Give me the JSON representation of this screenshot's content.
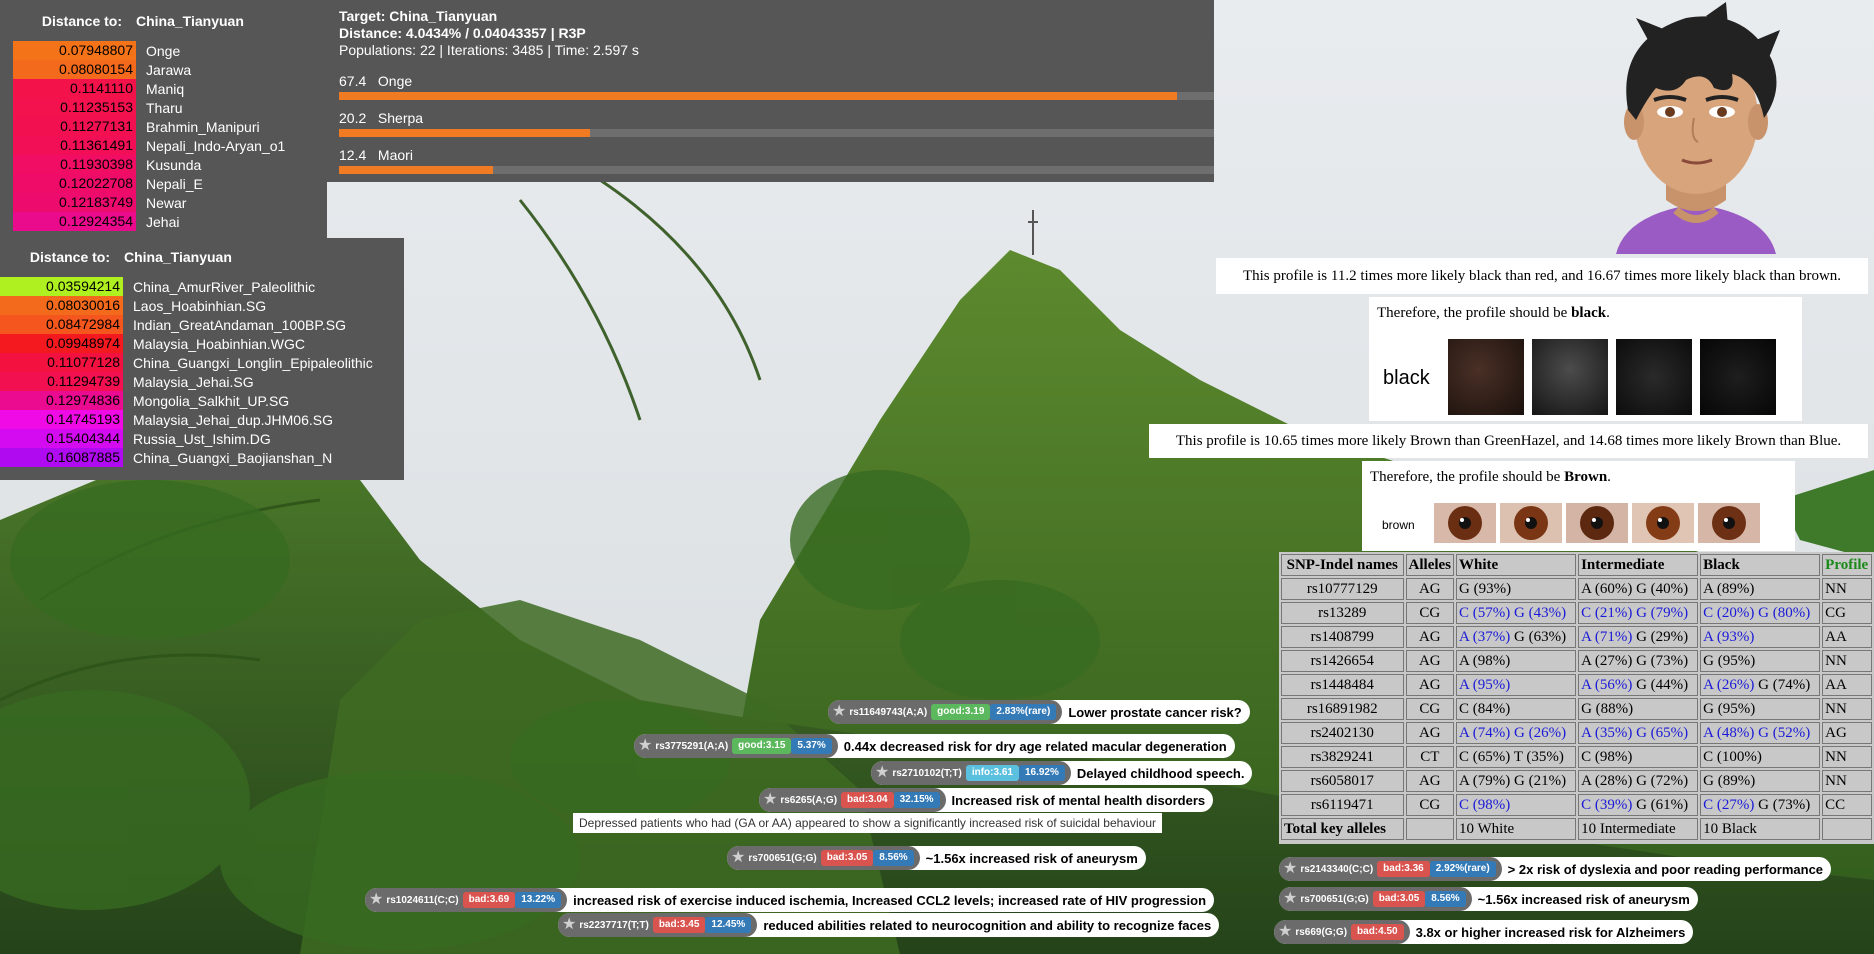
{
  "distance_panel_1": {
    "header_label": "Distance to:",
    "header_target": "China_Tianyuan",
    "rows": [
      {
        "value": "0.07948807",
        "name": "Onge",
        "color": "#f47318"
      },
      {
        "value": "0.08080154",
        "name": "Jarawa",
        "color": "#f46a1c"
      },
      {
        "value": "0.1141110",
        "name": "Maniq",
        "color": "#f3124a"
      },
      {
        "value": "0.11235153",
        "name": "Tharu",
        "color": "#f3114e"
      },
      {
        "value": "0.11277131",
        "name": "Brahmin_Manipuri",
        "color": "#f31051"
      },
      {
        "value": "0.11361491",
        "name": "Nepali_Indo-Aryan_o1",
        "color": "#f30f55"
      },
      {
        "value": "0.11930398",
        "name": "Kusunda",
        "color": "#f00d63"
      },
      {
        "value": "0.12022708",
        "name": "Nepali_E",
        "color": "#ef0c68"
      },
      {
        "value": "0.12183749",
        "name": "Newar",
        "color": "#ee0b6e"
      },
      {
        "value": "0.12924354",
        "name": "Jehai",
        "color": "#ea0b8c"
      }
    ]
  },
  "distance_panel_2": {
    "header_label": "Distance to:",
    "header_target": "China_Tianyuan",
    "rows": [
      {
        "value": "0.03594214",
        "name": "China_AmurRiver_Paleolithic",
        "color": "#aef020"
      },
      {
        "value": "0.08030016",
        "name": "Laos_Hoabinhian.SG",
        "color": "#f46a1c"
      },
      {
        "value": "0.08472984",
        "name": "Indian_GreatAndaman_100BP.SG",
        "color": "#f4561e"
      },
      {
        "value": "0.09948974",
        "name": "Malaysia_Hoabinhian.WGC",
        "color": "#f4191e"
      },
      {
        "value": "0.11077128",
        "name": "China_Guangxi_Longlin_Epipaleolithic",
        "color": "#f3123f"
      },
      {
        "value": "0.11294739",
        "name": "Malaysia_Jehai.SG",
        "color": "#f31050"
      },
      {
        "value": "0.12974836",
        "name": "Mongolia_Salkhit_UP.SG",
        "color": "#ea0b90"
      },
      {
        "value": "0.14745193",
        "name": "Malaysia_Jehai_dup.JHM06.SG",
        "color": "#f00ae6"
      },
      {
        "value": "0.15404344",
        "name": "Russia_Ust_Ishim.DG",
        "color": "#d40af0"
      },
      {
        "value": "0.16087885",
        "name": "China_Guangxi_Baojianshan_N",
        "color": "#b00af0"
      }
    ]
  },
  "target_panel": {
    "target_line": "Target: China_Tianyuan",
    "distance_line": "Distance: 4.0434% / 0.04043357 | R3P",
    "stats_line": "Populations: 22 | Iterations: 3485 | Time: 2.597 s",
    "entries": [
      {
        "label": "67.4   Onge",
        "percent": 67.4
      },
      {
        "label": "20.2   Sherpa",
        "percent": 20.2
      },
      {
        "label": "12.4   Maori",
        "percent": 12.4
      }
    ]
  },
  "hair": {
    "ratio_text": "This profile is 11.2 times more likely black than red, and 16.67 times more likely black than brown.",
    "conclusion_prefix": "Therefore, the profile should be ",
    "conclusion_value": "black",
    "conclusion_suffix": ".",
    "swatch_label": "black"
  },
  "eyes": {
    "ratio_text": "This profile is 10.65 times more likely Brown than GreenHazel, and 14.68 times more likely Brown than Blue.",
    "conclusion_prefix": "Therefore, the profile should be ",
    "conclusion_value": "Brown",
    "conclusion_suffix": ".",
    "swatch_label": "brown"
  },
  "snp_table": {
    "headers": [
      "SNP-Indel names",
      "Alleles",
      "White",
      "Intermediate",
      "Black",
      "Profile"
    ],
    "rows": [
      {
        "name": "rs10777129",
        "alleles": "AG",
        "white": "G (93%)",
        "white_blue": false,
        "inter": "A (60%) G (40%)",
        "inter_blue": false,
        "black": "A (89%)",
        "black_blue": false,
        "profile": "NN"
      },
      {
        "name": "rs13289",
        "alleles": "CG",
        "white": "C (57%) G (43%)",
        "white_blue": true,
        "inter": "C (21%) G (79%)",
        "inter_blue": true,
        "black": "C (20%) G (80%)",
        "black_blue": true,
        "profile": "CG"
      },
      {
        "name": "rs1408799",
        "alleles": "AG",
        "white": "A (37%) G (63%)",
        "white_blue": "partial",
        "inter": "A (71%) G (29%)",
        "inter_blue": "partial",
        "black": "A (93%)",
        "black_blue": true,
        "profile": "AA"
      },
      {
        "name": "rs1426654",
        "alleles": "AG",
        "white": "A (98%)",
        "white_blue": false,
        "inter": "A (27%) G (73%)",
        "inter_blue": false,
        "black": "G (95%)",
        "black_blue": false,
        "profile": "NN"
      },
      {
        "name": "rs1448484",
        "alleles": "AG",
        "white": "A (95%)",
        "white_blue": true,
        "inter": "A (56%) G (44%)",
        "inter_blue": "partial",
        "black": "A (26%) G (74%)",
        "black_blue": "partial",
        "profile": "AA"
      },
      {
        "name": "rs16891982",
        "alleles": "CG",
        "white": "C (84%)",
        "white_blue": false,
        "inter": "G (88%)",
        "inter_blue": false,
        "black": "G (95%)",
        "black_blue": false,
        "profile": "NN"
      },
      {
        "name": "rs2402130",
        "alleles": "AG",
        "white": "A (74%) G (26%)",
        "white_blue": true,
        "inter": "A (35%) G (65%)",
        "inter_blue": true,
        "black": "A (48%) G (52%)",
        "black_blue": true,
        "profile": "AG"
      },
      {
        "name": "rs3829241",
        "alleles": "CT",
        "white": "C (65%) T (35%)",
        "white_blue": false,
        "inter": "C (98%)",
        "inter_blue": false,
        "black": "C (100%)",
        "black_blue": false,
        "profile": "NN"
      },
      {
        "name": "rs6058017",
        "alleles": "AG",
        "white": "A (79%) G (21%)",
        "white_blue": false,
        "inter": "A (28%) G (72%)",
        "inter_blue": false,
        "black": "G (89%)",
        "black_blue": false,
        "profile": "NN"
      },
      {
        "name": "rs6119471",
        "alleles": "CG",
        "white": "C (98%)",
        "white_blue": true,
        "inter": "C (39%) G (61%)",
        "inter_blue": "partial",
        "black": "C (27%) G (73%)",
        "black_blue": "partial",
        "profile": "CC"
      }
    ],
    "total_label": "Total key alleles",
    "total_white": "10 White",
    "total_inter": "10 Intermediate",
    "total_black": "10 Black"
  },
  "pills": [
    {
      "rsid": "rs11649743(A;A)",
      "badge": "good:3.19",
      "kind": "good",
      "pct": "2.83%(rare)",
      "text": "Lower prostate cancer risk?"
    },
    {
      "rsid": "rs3775291(A;A)",
      "badge": "good:3.15",
      "kind": "good",
      "pct": "5.37%",
      "text": "0.44x decreased risk for dry age related macular degeneration"
    },
    {
      "rsid": "rs2710102(T;T)",
      "badge": "info:3.61",
      "kind": "info",
      "pct": "16.92%",
      "text": "Delayed childhood speech."
    },
    {
      "rsid": "rs6265(A;G)",
      "badge": "bad:3.04",
      "kind": "bad",
      "pct": "32.15%",
      "text": "Increased risk of mental health disorders"
    },
    {
      "rsid": "rs700651(G;G)",
      "badge": "bad:3.05",
      "kind": "bad",
      "pct": "8.56%",
      "text": "~1.56x increased risk of aneurysm"
    },
    {
      "rsid": "rs1024611(C;C)",
      "badge": "bad:3.69",
      "kind": "bad",
      "pct": "13.22%",
      "text": "increased risk of exercise induced ischemia, Increased CCL2 levels; increased rate of HIV progression"
    },
    {
      "rsid": "rs2237717(T;T)",
      "badge": "bad:3.45",
      "kind": "bad",
      "pct": "12.45%",
      "text": "reduced abilities related to neurocognition and ability to recognize faces"
    },
    {
      "rsid": "rs2143340(C;C)",
      "badge": "bad:3.36",
      "kind": "bad",
      "pct": "2.92%(rare)",
      "text": "> 2x risk of dyslexia and poor reading performance"
    },
    {
      "rsid": "rs700651(G;G)",
      "badge": "bad:3.05",
      "kind": "bad",
      "pct": "8.56%",
      "text": "~1.56x increased risk of aneurysm"
    },
    {
      "rsid": "rs669(G;G)",
      "badge": "bad:4.50",
      "kind": "bad",
      "pct": "",
      "text": "3.8x or higher increased risk for Alzheimers"
    }
  ],
  "note_suicide": "Depressed patients who had (GA or AA) appeared to show a significantly increased risk of suicidal behaviour"
}
